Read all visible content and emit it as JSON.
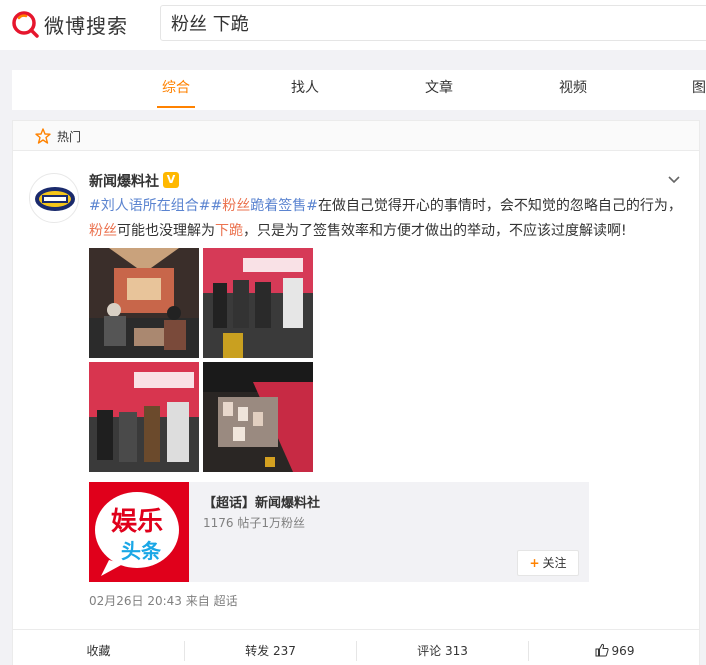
{
  "header": {
    "logo_text": "微博搜索",
    "search_value": "粉丝 下跪"
  },
  "tabs": [
    {
      "label": "综合",
      "active": true
    },
    {
      "label": "找人",
      "active": false
    },
    {
      "label": "文章",
      "active": false
    },
    {
      "label": "视频",
      "active": false
    },
    {
      "label": "图",
      "active": false
    }
  ],
  "hot_section": {
    "label": "热门"
  },
  "post": {
    "user_name": "新闻爆料社",
    "badge": "V",
    "content": {
      "tag1": "#刘人语所在组合#",
      "tag2_pre": "#",
      "tag2_keyword": "粉丝",
      "tag2_post": "跪着签售#",
      "text1": "在做自己觉得开心的事情时，会不知觉的忽略自己的行为，",
      "keyword1": "粉丝",
      "text2": "可能也没理解为",
      "keyword2": "下跪",
      "text3": "，只是为了签售效率和方便才做出的举动，不应该过度解读啊!"
    },
    "superchat": {
      "title": "【超话】新闻爆料社",
      "meta": "1176 帖子1万粉丝",
      "follow_label": "关注",
      "logo_line1": "娱乐",
      "logo_line2": "头条"
    },
    "timestamp": "02月26日 20:43 来自 超话",
    "actions": {
      "collect": "收藏",
      "repost": "转发 237",
      "comment": "评论 313",
      "like": "969"
    }
  },
  "colors": {
    "accent": "#ff8200",
    "link": "#5b84d0",
    "keyword": "#eb7350"
  }
}
